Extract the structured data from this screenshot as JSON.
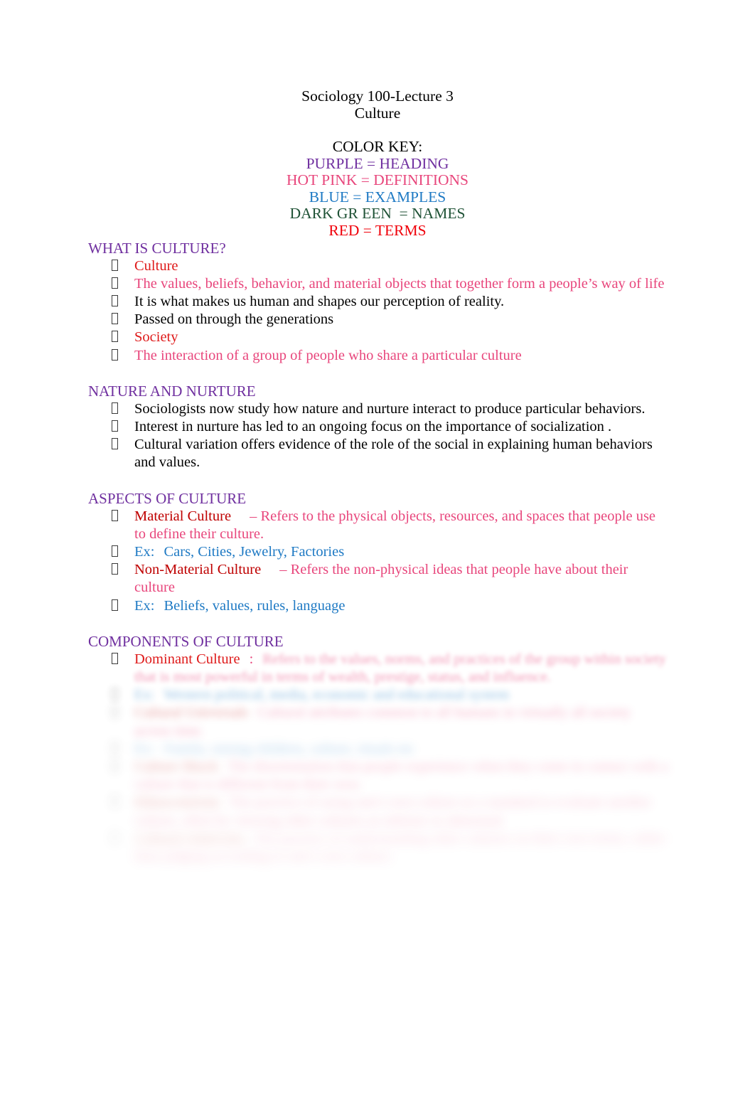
{
  "document": {
    "title_lines": [
      "Sociology 100-Lecture 3",
      "Culture"
    ],
    "color_key": {
      "heading_label": "COLOR KEY:",
      "entries": [
        {
          "label": "PURPLE = HEADING",
          "color": "#7030A0"
        },
        {
          "label": "HOT PINK = DEFINITIONS",
          "color": "#E8467C"
        },
        {
          "label": "BLUE = EXAMPLES",
          "color": "#1F7AC4"
        },
        {
          "label": "DARK GR EEN  = NAMES",
          "color": "#1F5236"
        },
        {
          "label": "RED = TERMS",
          "color": "#F0000A"
        }
      ]
    },
    "sections": [
      {
        "heading": "WHAT IS CULTURE?",
        "bullets": [
          {
            "term": "Culture",
            "style": "term"
          },
          {
            "term": "The values, beliefs, behavior, and material objects that together form a people’s way of life",
            "style": "definition"
          },
          {
            "term": "It is what makes us human and shapes our perception of reality.",
            "style": "plain"
          },
          {
            "term": "Passed on through the generations",
            "style": "plain"
          },
          {
            "term": "Society",
            "style": "term"
          },
          {
            "term": "The interaction of a group of people who share a particular culture",
            "style": "definition"
          }
        ]
      },
      {
        "heading": "NATURE AND NURTURE",
        "bullets": [
          {
            "term": "Sociologists now study how nature and nurture interact to produce particular behaviors.",
            "style": "plain"
          },
          {
            "term": "Interest in nurture has led to an ongoing focus on the importance of socialization .",
            "style": "plain"
          },
          {
            "term": "Cultural variation offers evidence of the role of the social in explaining human behaviors and values.",
            "style": "plain"
          }
        ]
      },
      {
        "heading": "ASPECTS OF CULTURE",
        "bullets": [
          {
            "term": "Material Culture",
            "dash": "– Refers to the physical objects, resources, and spaces that people use to define their culture.",
            "style": "term-definition"
          },
          {
            "label": "Ex:",
            "term": "Cars, Cities, Jewelry, Factories",
            "style": "example"
          },
          {
            "term": "Non-Material Culture",
            "dash": "– Refers the non-physical ideas that people have about their culture",
            "style": "term-definition"
          },
          {
            "label": "Ex:",
            "term": "Beliefs, values, rules, language",
            "style": "example"
          }
        ]
      },
      {
        "heading": "COMPONENTS OF CULTURE",
        "blurred": true,
        "bullets": [
          {
            "term": "Dominant Culture",
            "colon": ":",
            "dash": "Refers to the values, norms, and practices of the group within",
            "cont": "society that is most powerful in terms of wealth, prestige, status, and influence.",
            "style": "term-definition",
            "blur_level": 1
          },
          {
            "label": "Ex:",
            "term": "Western political, media, economic and educational system",
            "style": "example",
            "blur_level": 2
          },
          {
            "term": "Cultural Universals",
            "dash": "Cultural attributes common to all humans in virtually all society",
            "cont": "across time.",
            "style": "term-definition",
            "blur_level": 3
          },
          {
            "label": "Ex:",
            "term": "Family, raising children, culture, rituals etc",
            "style": "example",
            "blur_level": 4
          },
          {
            "term": "Culture Shock",
            "dash": "The disorientation that people experience when they come in contact with a",
            "cont": "culture that is different from their own.",
            "style": "term-definition",
            "blur_level": 4
          },
          {
            "term": "Ethnocentrism",
            "dash": "The practice of using one's own culture as a standard to evaluate another",
            "cont": "culture, often by viewing other cultures as inferior or abnormal.",
            "style": "term-definition",
            "blur_level": 5
          },
          {
            "term": "Cultural relativism",
            "dash": "The practice of understanding other cultures on their own terms, rather than",
            "cont": "judging according to one's own culture.",
            "style": "term-definition",
            "blur_level": 6
          }
        ]
      }
    ]
  }
}
